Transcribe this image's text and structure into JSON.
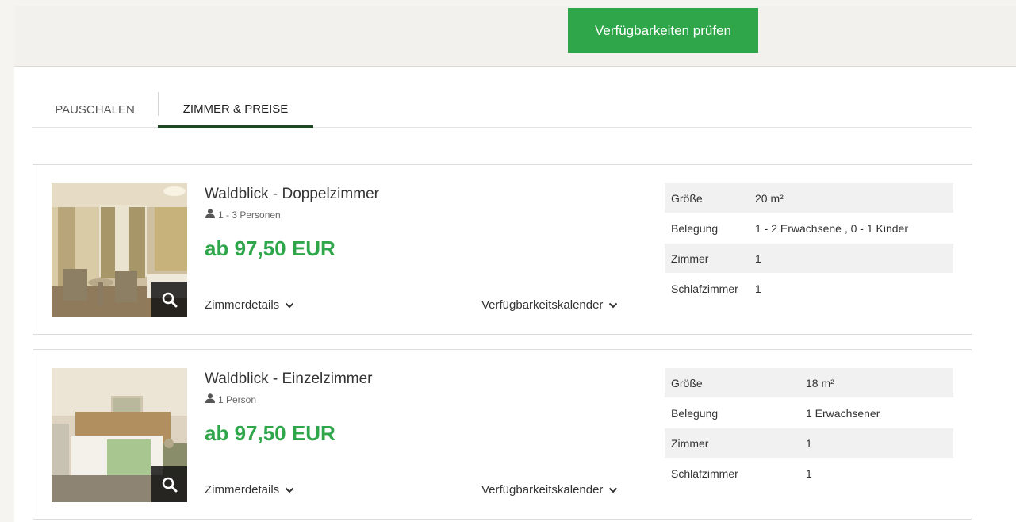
{
  "header": {
    "check_button_label": "Verfügbarkeiten prüfen"
  },
  "tabs": [
    {
      "label": "PAUSCHALEN",
      "active": false
    },
    {
      "label": "ZIMMER & PREISE",
      "active": true
    }
  ],
  "rooms": [
    {
      "title": "Waldblick - Doppelzimmer",
      "persons": "1 - 3 Personen",
      "price": "ab 97,50 EUR",
      "details_link": "Zimmerdetails",
      "calendar_link": "Verfügbarkeitskalender",
      "facts": [
        {
          "label": "Größe",
          "value": "20 m²"
        },
        {
          "label": "Belegung",
          "value": "1 - 2 Erwachsene , 0 - 1 Kinder"
        },
        {
          "label": "Zimmer",
          "value": "1"
        },
        {
          "label": "Schlafzimmer",
          "value": "1"
        }
      ]
    },
    {
      "title": "Waldblick - Einzelzimmer",
      "persons": "1 Person",
      "price": "ab 97,50 EUR",
      "details_link": "Zimmerdetails",
      "calendar_link": "Verfügbarkeitskalender",
      "facts": [
        {
          "label": "Größe",
          "value": "18 m²"
        },
        {
          "label": "Belegung",
          "value": "1 Erwachsener"
        },
        {
          "label": "Zimmer",
          "value": "1"
        },
        {
          "label": "Schlafzimmer",
          "value": "1"
        }
      ]
    }
  ],
  "colors": {
    "accent_green": "#2fa64a",
    "tab_underline": "#1d4a25"
  },
  "icons": {
    "person": "person-icon",
    "zoom": "magnifier-icon",
    "chevron": "chevron-down-icon"
  }
}
